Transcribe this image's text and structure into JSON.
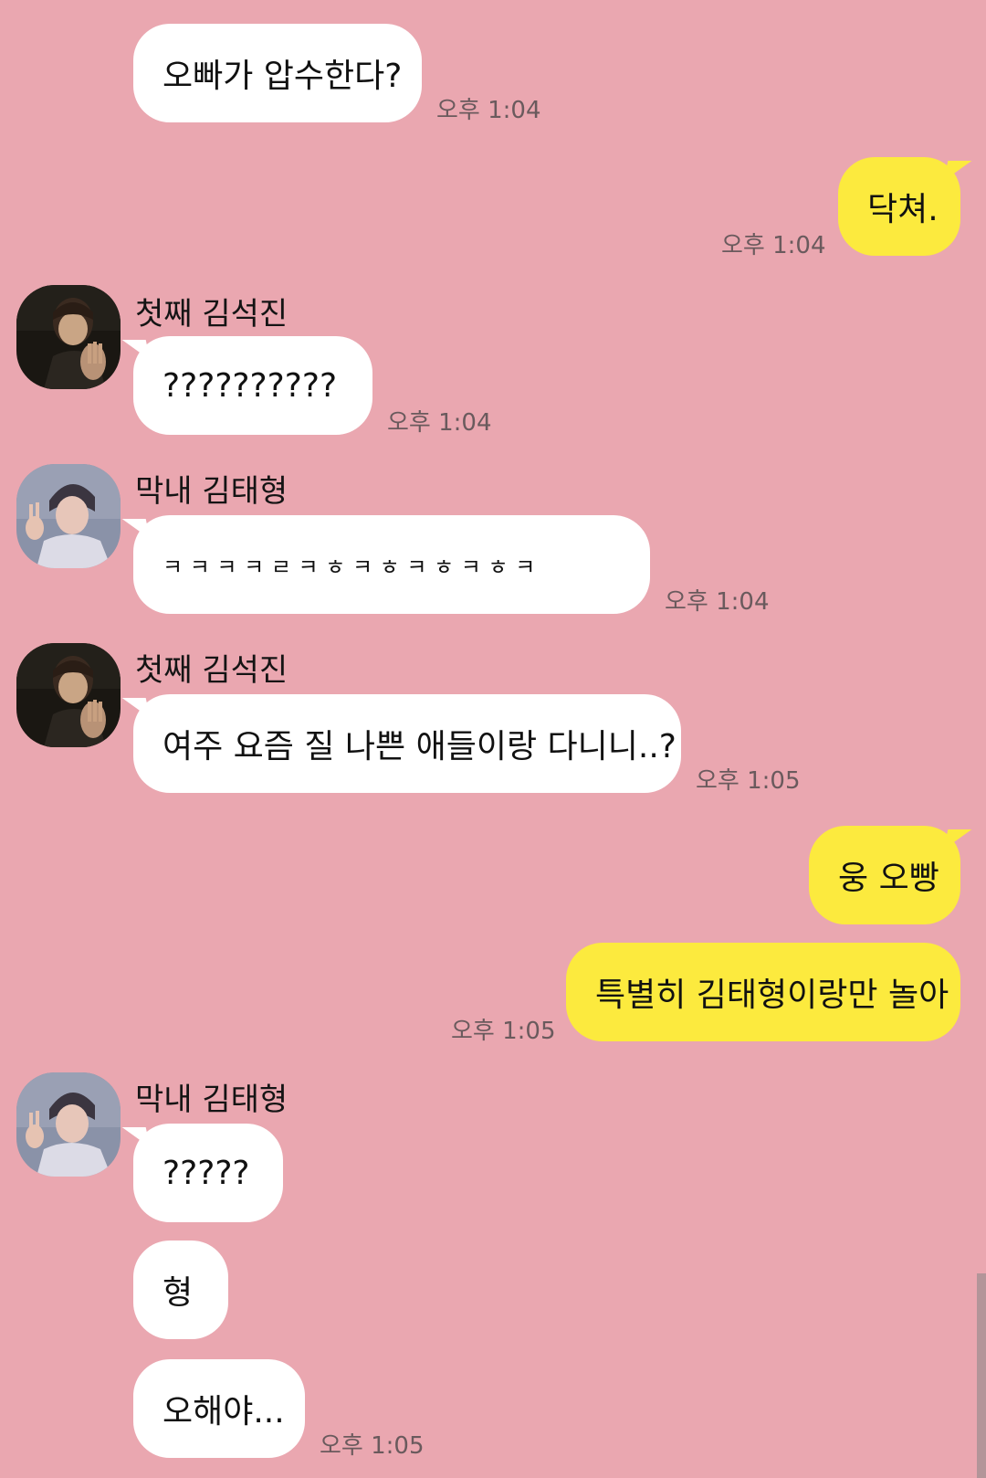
{
  "chat": {
    "messages": [
      {
        "side": "in",
        "text": "오빠가 압수한다?",
        "time": "오후 1:04"
      },
      {
        "side": "out",
        "text": "닥쳐.",
        "time": "오후 1:04"
      },
      {
        "side": "in",
        "sender": "첫째 김석진",
        "avatar": "seokjin-avatar",
        "text": "??????????",
        "time": "오후 1:04"
      },
      {
        "side": "in",
        "sender": "막내 김태형",
        "avatar": "taehyung-avatar",
        "text": "ㅋ ㅋ ㅋ ㅋ ㄹ ㅋ ㅎ ㅋ ㅎ ㅋ ㅎ ㅋ ㅎ ㅋ",
        "time": "오후 1:04"
      },
      {
        "side": "in",
        "sender": "첫째 김석진",
        "avatar": "seokjin-avatar",
        "text": "여주 요즘 질 나쁜 애들이랑 다니니..?",
        "time": "오후 1:05"
      },
      {
        "side": "out",
        "text": "웅 오빵"
      },
      {
        "side": "out",
        "text": "특별히 김태형이랑만 놀아",
        "time": "오후 1:05"
      },
      {
        "side": "in",
        "sender": "막내 김태형",
        "avatar": "taehyung-avatar",
        "text": "?????"
      },
      {
        "side": "in",
        "text": "형"
      },
      {
        "side": "in",
        "text": "오해야...",
        "time": "오후 1:05"
      }
    ]
  },
  "colors": {
    "background": "#eaa7b0",
    "incoming_bubble": "#ffffff",
    "outgoing_bubble": "#fcea3e",
    "timestamp": "#6a5a5d"
  }
}
